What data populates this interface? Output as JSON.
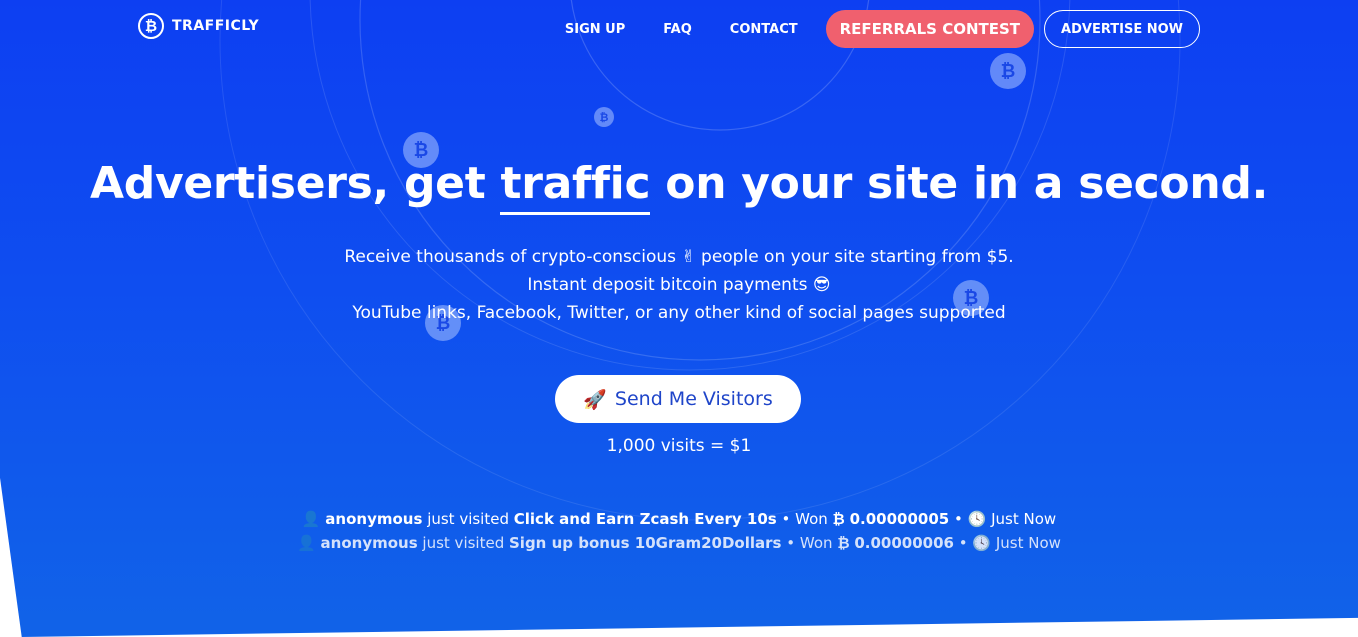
{
  "brand": {
    "name": "TRAFFICLY",
    "logo_glyph": "₿"
  },
  "nav": {
    "links": [
      "SIGN UP",
      "FAQ",
      "CONTACT"
    ],
    "contest_label": "REFERRALS CONTEST",
    "advertise_label": "ADVERTISE NOW"
  },
  "hero": {
    "headline_before": "Advertisers, get",
    "headline_highlight": "traffic",
    "headline_after": "on your site in a second.",
    "lines": [
      "Receive thousands of crypto-conscious ✌ people on your site starting from $5.",
      "Instant deposit bitcoin payments 😎",
      "YouTube links, Facebook, Twitter, or any other kind of social pages supported"
    ],
    "cta_icon": "🚀",
    "cta_label": "Send Me Visitors",
    "rate": "1,000 visits = $1"
  },
  "feed": [
    {
      "user": "anonymous",
      "action": "just visited",
      "site": "Click and Earn Zcash Every 10s",
      "won_label": "Won",
      "amount": "0.00000005",
      "time": "Just Now"
    },
    {
      "user": "anonymous",
      "action": "just visited",
      "site": "Sign up bonus 10Gram20Dollars",
      "won_label": "Won",
      "amount": "0.00000006",
      "time": "Just Now"
    }
  ],
  "glyphs": {
    "user": "👤",
    "coin": "₿",
    "clock": "🕓",
    "sep": "•"
  },
  "colors": {
    "hero_blue": "#0d3ff2",
    "contest_red": "#f0606e",
    "cta_text": "#1f45c9"
  }
}
